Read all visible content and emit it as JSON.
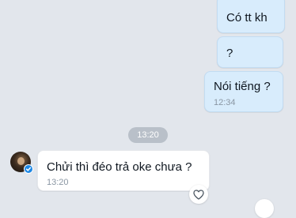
{
  "conversation": {
    "messages": [
      {
        "direction": "outgoing",
        "text": "Có tt kh",
        "time": ""
      },
      {
        "direction": "outgoing",
        "text": "?",
        "time": ""
      },
      {
        "direction": "outgoing",
        "text": "Nói tiếng ?",
        "time": "12:34"
      },
      {
        "direction": "incoming",
        "text": "Chửi thì đéo trả oke chưa ?",
        "time": "13:20"
      }
    ],
    "separator_time": "13:20"
  },
  "sender": {
    "avatar_icon": "user-avatar",
    "verified_icon": "verified-badge-icon"
  },
  "reaction": {
    "icon": "heart-outline-icon"
  },
  "colors": {
    "background": "#e2e6ec",
    "outgoing_bubble": "#d8ecfc",
    "incoming_bubble": "#ffffff",
    "time_pill": "#b9c0c9",
    "verified": "#1e88e5"
  }
}
